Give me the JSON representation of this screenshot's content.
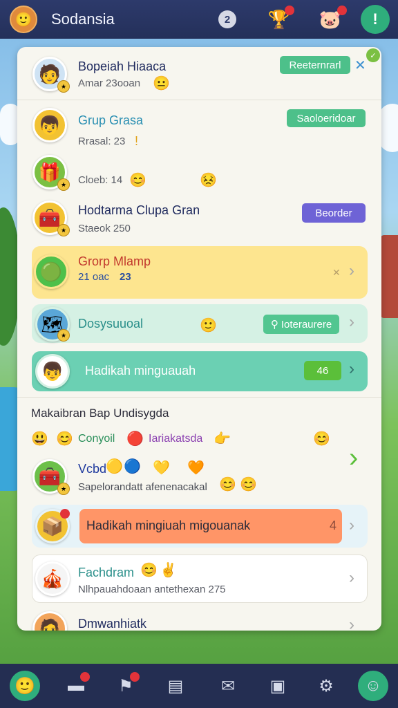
{
  "header": {
    "title": "Sodansia",
    "count": "2"
  },
  "top_card": {
    "name": "Bopeiah Hiaaca",
    "sub": "Amar 23ooan",
    "button": "Reeternrarl"
  },
  "groups": [
    {
      "name": "Grup Grasa",
      "sub": "Rrasal: 23",
      "button": "Saoloeridoar"
    },
    {
      "sub": "Cloeb: 14"
    },
    {
      "name": "Hodtarma Clupa Gran",
      "sub": "Staeok 250",
      "button": "Beorder"
    },
    {
      "name": "Grorp Mlamp",
      "sub": "21 oac",
      "count": "23"
    },
    {
      "name": "Dosysuuoal",
      "button": "Ioteraurere"
    },
    {
      "name": "Hadikah minguauah",
      "count": "46"
    }
  ],
  "section": {
    "title": "Makaibran Bap Undisygda",
    "row1": {
      "a": "Conyoil",
      "b": "Iariakatsda"
    },
    "row2": {
      "name": "Vcbd",
      "sub": "Sapelorandatt afenenacakal"
    },
    "row3": {
      "name": "Hadikah mingiuah migouanak",
      "count": "4"
    },
    "row4": {
      "name": "Fachdram",
      "sub": "Nlhpauahdoaan antethexan 275"
    },
    "row5": {
      "name": "Dmwanhiatk"
    }
  },
  "colors": {
    "accent_green": "#2fae7c",
    "pill_green": "#4dc08a",
    "pill_purple": "#6e63d6",
    "yellow_card": "#fde58f",
    "mint_card": "#d5f1e4",
    "teal_card": "#6bd0b3",
    "orange_card": "#ff9567"
  },
  "icons": [
    "avatar-icon",
    "notification-icon",
    "chat-icon",
    "help-icon",
    "close-icon",
    "chevron-right-icon",
    "home-icon",
    "inbox-icon",
    "gift-icon",
    "calendar-icon",
    "message-icon",
    "store-icon",
    "settings-icon",
    "emoji-icon"
  ]
}
